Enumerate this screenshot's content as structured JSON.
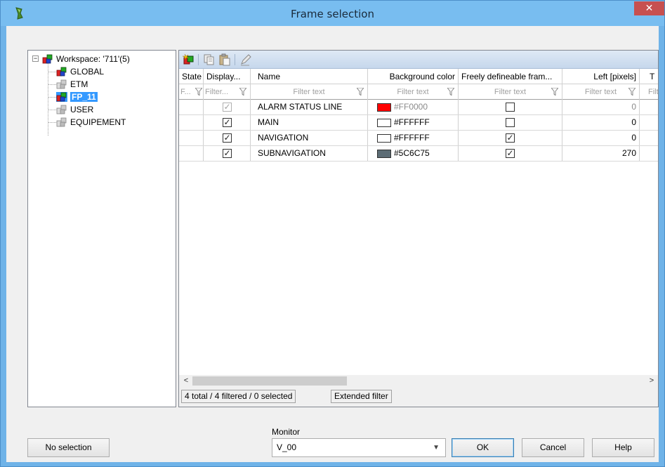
{
  "window": {
    "title": "Frame selection",
    "close_glyph": "✕"
  },
  "tree": {
    "root": {
      "label": "Workspace: '711'(5)",
      "expander": "−"
    },
    "items": [
      {
        "label": "GLOBAL",
        "selected": false,
        "icon": "frame-colored-icon"
      },
      {
        "label": "ETM",
        "selected": false,
        "icon": "frame-gray-icon"
      },
      {
        "label": "FP_11",
        "selected": true,
        "icon": "frame-colored-icon"
      },
      {
        "label": "USER",
        "selected": false,
        "icon": "frame-gray-icon"
      },
      {
        "label": "EQUIPEMENT",
        "selected": false,
        "icon": "frame-gray-icon"
      }
    ]
  },
  "toolbar": {
    "buttons": [
      "new-frame-icon",
      "copy-icon",
      "paste-icon",
      "edit-icon"
    ]
  },
  "grid": {
    "columns": [
      "State",
      "Display...",
      "Name",
      "Background color",
      "Freely defineable fram...",
      "Left [pixels]",
      "T"
    ],
    "filters": [
      "F...",
      "Filter...",
      "Filter text",
      "Filter text",
      "Filter text",
      "Filter text",
      "Filt"
    ],
    "rows": [
      {
        "display": true,
        "display_enabled": false,
        "name": "ALARM STATUS LINE",
        "color": "#FF0000",
        "color_label": "#FF0000",
        "color_enabled": false,
        "freely": false,
        "left": "0",
        "left_enabled": false
      },
      {
        "display": true,
        "display_enabled": true,
        "name": "MAIN",
        "color": "#FFFFFF",
        "color_label": "#FFFFFF",
        "color_enabled": true,
        "freely": false,
        "left": "0",
        "left_enabled": true
      },
      {
        "display": true,
        "display_enabled": true,
        "name": "NAVIGATION",
        "color": "#FFFFFF",
        "color_label": "#FFFFFF",
        "color_enabled": true,
        "freely": true,
        "left": "0",
        "left_enabled": true
      },
      {
        "display": true,
        "display_enabled": true,
        "name": "SUBNAVIGATION",
        "color": "#5C6C75",
        "color_label": "#5C6C75",
        "color_enabled": true,
        "freely": true,
        "left": "270",
        "left_enabled": true
      }
    ],
    "scroll_left": "<",
    "scroll_right": ">"
  },
  "status": {
    "summary": "4 total / 4 filtered / 0 selected",
    "extended_filter": "Extended filter"
  },
  "footer": {
    "no_selection": "No selection",
    "monitor_label": "Monitor",
    "monitor_value": "V_00",
    "ok": "OK",
    "cancel": "Cancel",
    "help": "Help"
  },
  "colors": {
    "titlebar": "#78bdf0",
    "selection": "#3399ff",
    "close": "#c75050"
  }
}
